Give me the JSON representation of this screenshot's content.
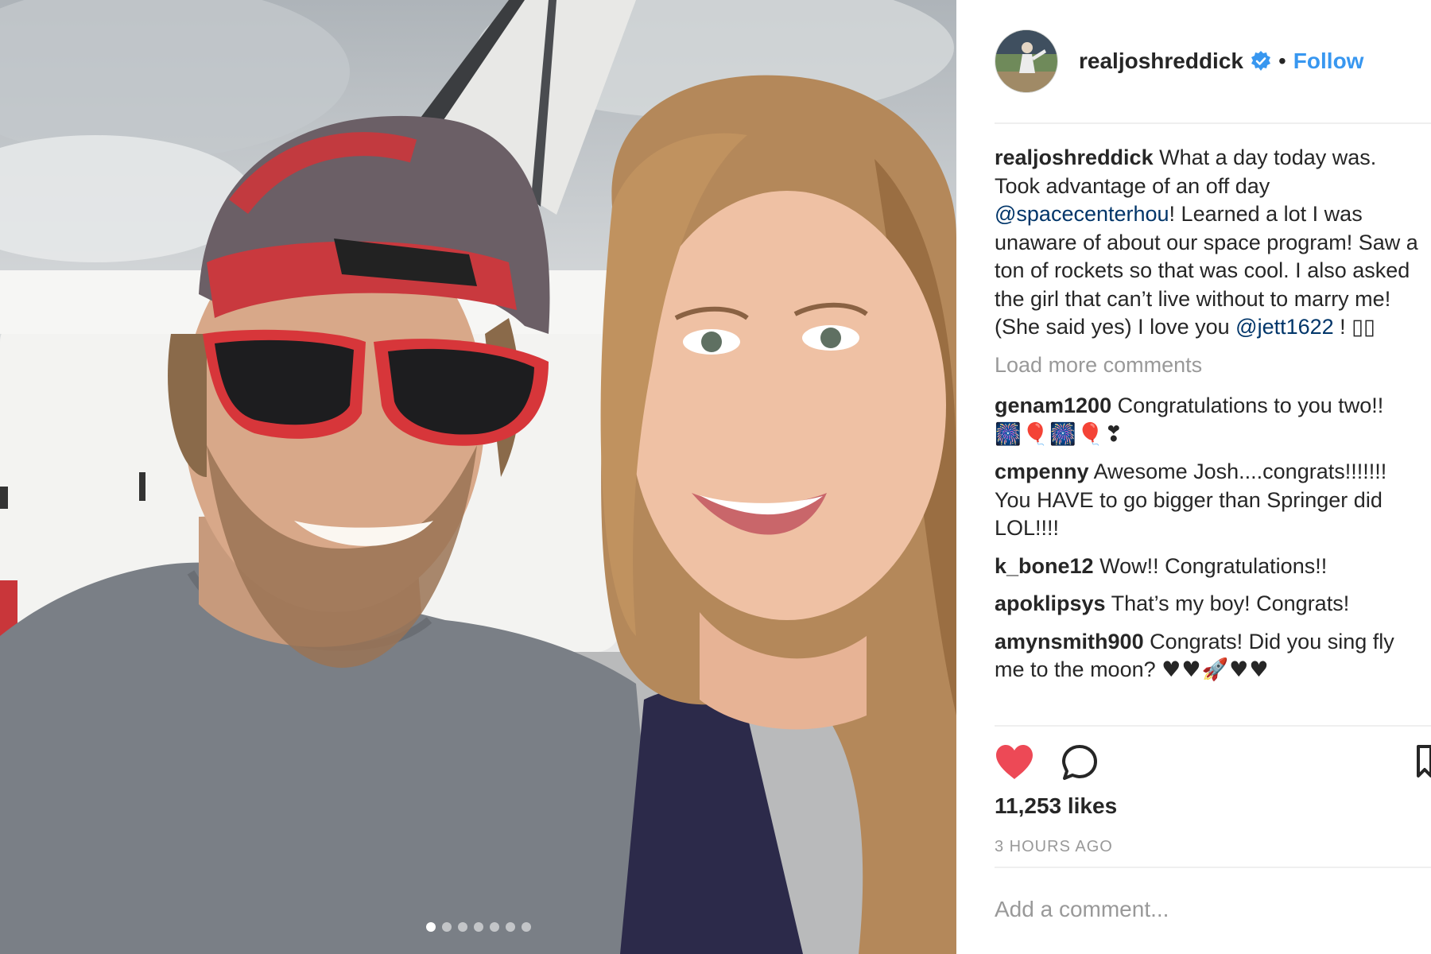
{
  "post": {
    "username": "realjoshreddick",
    "follow_label": "Follow",
    "separator": "•",
    "verified_icon": "verified-badge-icon"
  },
  "photo": {
    "carousel_count": 7,
    "active_index": 0
  },
  "caption": {
    "user": "realjoshreddick",
    "text_1": "What a day today was. Took advantage of an off day ",
    "mention_1": "@spacecenterhou",
    "text_2": "! Learned a lot I was unaware of about our space program! Saw a ton of rockets so that was cool. I also asked the girl that can’t live without to marry me! (She said yes) I love you ",
    "mention_2": "@jett1622",
    "text_3": " ! ▯▯"
  },
  "load_more_label": "Load more comments",
  "comments": [
    {
      "user": "genam1200",
      "text": "Congratulations to you two!!",
      "emoji": "🎆🎈🎆🎈❣"
    },
    {
      "user": "cmpenny",
      "text": "Awesome Josh....congrats!!!!!!! You HAVE to go bigger than Springer did LOL!!!!"
    },
    {
      "user": "k_bone12",
      "text": "Wow!! Congratulations!!"
    },
    {
      "user": "apoklipsys",
      "text": "That’s my boy! Congrats!"
    },
    {
      "user": "amynsmith900",
      "text": "Congrats! Did you sing fly me to the moon? ",
      "emoji": "♥♥🚀♥♥"
    }
  ],
  "actions": {
    "like_icon": "heart-filled-icon",
    "comment_icon": "comment-bubble-icon",
    "save_icon": "bookmark-icon",
    "like_color": "#ed4956"
  },
  "likes_label": "11,253 likes",
  "timestamp": "3 HOURS AGO",
  "add_comment_placeholder": "Add a comment..."
}
